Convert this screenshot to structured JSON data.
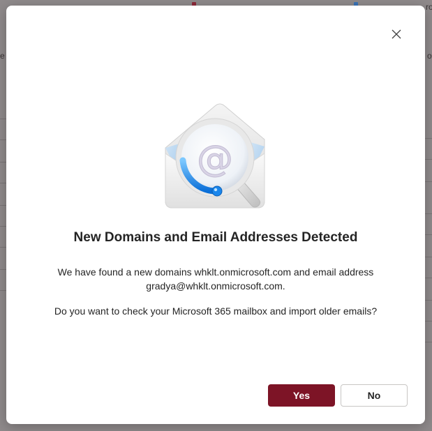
{
  "background": {
    "fragments": [
      "e",
      "o",
      "ro"
    ]
  },
  "dialog": {
    "close_icon": "close-icon",
    "hero_icon": "email-search-icon",
    "title": "New Domains and Email Addresses Detected",
    "message_line1": "We have found a new domains whklt.onmicrosoft.com and email address",
    "message_line2": "gradya@whklt.onmicrosoft.com.",
    "question": "Do you want to check your Microsoft 365 mailbox and import older emails?",
    "yes_label": "Yes",
    "no_label": "No"
  },
  "colors": {
    "primary_button": "#7d1426",
    "overlay": "#8f8a8b"
  }
}
